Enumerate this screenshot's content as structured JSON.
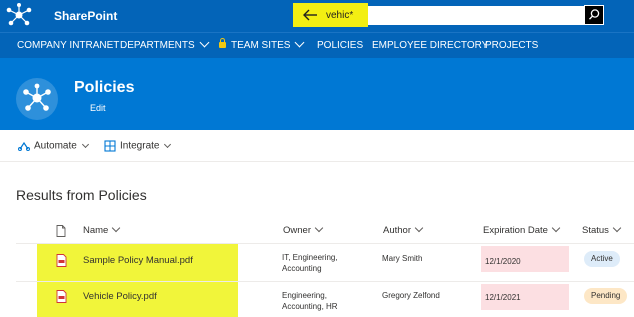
{
  "suitebar": {
    "app_name": "SharePoint",
    "search_value": "vehic*",
    "highlight_color": "#f3ef12"
  },
  "hubnav": {
    "items": [
      {
        "label": "COMPANY INTRANET"
      },
      {
        "label": "DEPARTMENTS"
      },
      {
        "label": "TEAM SITES"
      },
      {
        "label": "POLICIES"
      },
      {
        "label": "EMPLOYEE DIRECTORY"
      },
      {
        "label": "PROJECTS"
      }
    ]
  },
  "site": {
    "title": "Policies",
    "edit_label": "Edit"
  },
  "commandbar": {
    "automate_label": "Automate",
    "integrate_label": "Integrate"
  },
  "results": {
    "title": "Results from Policies",
    "columns": {
      "name": "Name",
      "owner": "Owner",
      "author": "Author",
      "expiration": "Expiration Date",
      "status": "Status"
    },
    "rows": [
      {
        "name": "Sample Policy Manual.pdf",
        "owner_line1": "IT, Engineering,",
        "owner_line2": "Accounting",
        "author": "Mary Smith",
        "expiration": "12/1/2020",
        "status": "Active"
      },
      {
        "name": "Vehicle Policy.pdf",
        "owner_line1": "Engineering,",
        "owner_line2": "Accounting, HR",
        "author": "Gregory Zelfond",
        "expiration": "12/1/2021",
        "status": "Pending"
      }
    ]
  },
  "colors": {
    "suite_blue": "#0364b8",
    "header_blue": "#0078d4",
    "row_highlight": "#f1f53a",
    "expired_date_bg": "#fcdfe2",
    "active_badge": "#deecf9",
    "pending_badge": "#fde7c6"
  },
  "icons": [
    "sharepoint-logo-icon",
    "back-arrow-icon",
    "search-icon",
    "lock-icon",
    "chevron-down-icon",
    "automate-icon",
    "integrate-icon",
    "document-icon",
    "pdf-file-icon"
  ]
}
